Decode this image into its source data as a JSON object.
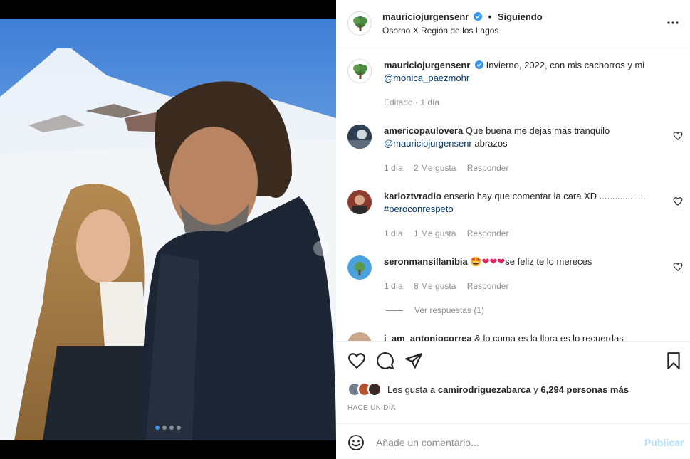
{
  "post": {
    "author": "mauriciojurgensenr",
    "follow_status": "Siguiendo",
    "location": "Osorno X Región de los Lagos",
    "caption_text": "Invierno, 2022, con mis cachorros y mi",
    "caption_mention": "@monica_paezmohr",
    "caption_meta": "Editado · 1 día",
    "carousel_count": 4,
    "carousel_active": 1
  },
  "comments": [
    {
      "user": "americopaulovera",
      "text": "Que buena me dejas mas tranquilo",
      "mention": "@mauriciojurgensenr",
      "after": "abrazos",
      "time": "1 día",
      "likes": "2 Me gusta",
      "reply": "Responder"
    },
    {
      "user": "karloztvradio",
      "text": "enserio hay que comentar la cara XD ..................",
      "mention": "#peroconrespeto",
      "time": "1 día",
      "likes": "1 Me gusta",
      "reply": "Responder"
    },
    {
      "user": "seronmansillanibia",
      "emojis": "🤩❤❤❤",
      "text": "se feliz te lo mereces",
      "time": "1 día",
      "likes": "8 Me gusta",
      "reply": "Responder",
      "view_replies": "Ver respuestas (1)"
    },
    {
      "user": "i_am_antoniocorrea",
      "text": "& lo cuma es la llora es lo recuerdas"
    }
  ],
  "likes_bar": {
    "prefix": "Les gusta a",
    "user": "camirodriguezabarca",
    "middle": "y",
    "count": "6,294 personas más"
  },
  "time_ago": "HACE UN DÍA",
  "add_comment": {
    "placeholder": "Añade un comentario...",
    "publish": "Publicar"
  },
  "colors": {
    "verified": "#3897f0",
    "link": "#00376b",
    "secondary": "#8e8e8e",
    "publish_disabled": "#b2dffc"
  }
}
